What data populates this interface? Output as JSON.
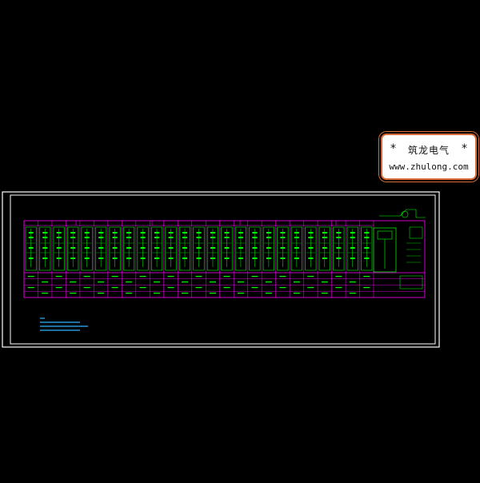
{
  "drawing": {
    "frame_color": "#ffffff",
    "panel_color": "#ff00ff",
    "line_color": "#00ff00",
    "note_color": "#2fb4ff",
    "cabinet_columns": 25,
    "lower_table_rows": 3
  },
  "watermark": {
    "star_left": "*",
    "star_right": "*",
    "brand_cn": "筑龙电气",
    "url": "www.zhulong.com",
    "border_color": "#d86a3c"
  }
}
